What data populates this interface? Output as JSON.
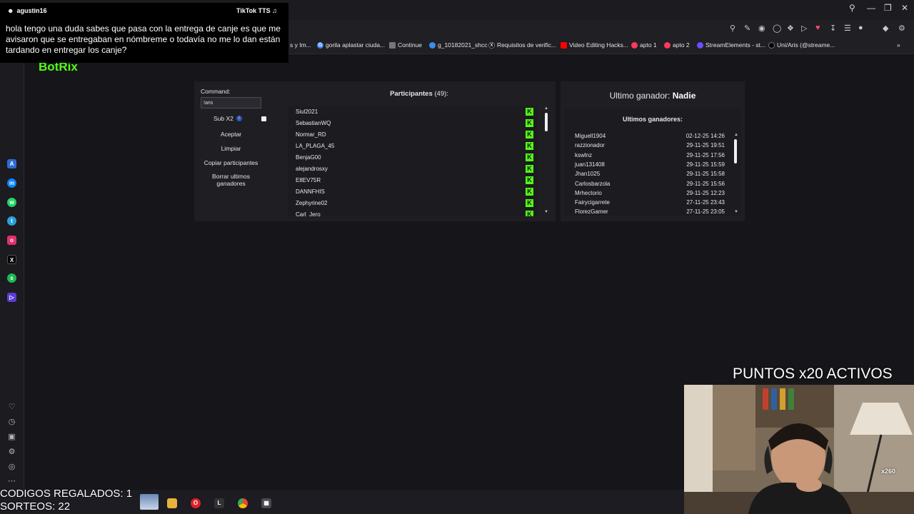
{
  "tts": {
    "user": "agustin16",
    "brand": "TikTok TTS",
    "message": "hola tengo una duda sabes que pasa con la entrega de canje es que me avisaron que se entregaban en nómbreme o todavía no me lo dan están tardando en entregar los canje?"
  },
  "bookmarks": [
    {
      "label": "s y Im..."
    },
    {
      "label": "gorila aplastar ciuda..."
    },
    {
      "label": "Continue"
    },
    {
      "label": "g_10182021_shcc"
    },
    {
      "label": "Requisitos de verific..."
    },
    {
      "label": "Video Editing Hacks..."
    },
    {
      "label": "apto 1"
    },
    {
      "label": "apto 2"
    },
    {
      "label": "StreamElements - st..."
    },
    {
      "label": "Uni/Aris (@streame..."
    }
  ],
  "brand": "BotRix",
  "giveaway": {
    "command_label": "Command:",
    "command_value": "!aris",
    "sub_label": "Sub X2",
    "buttons": {
      "accept": "Aceptar",
      "clear": "Limpiar",
      "copy": "Copiar participantes",
      "delete_winners": "Borrar ultimos ganadores"
    },
    "participants_label": "Participantes",
    "participants_count": "(49):",
    "participants": [
      "Siul2021",
      "SebastianWQ",
      "Normar_RD",
      "LA_PLAGA_45",
      "BenjaG00",
      "alejandrosxy",
      "E8EV75R",
      "DANNFHIS",
      "Zephyrine02",
      "Carl_Jero"
    ],
    "kick_badge": "K",
    "last_winner_label": "Ultimo ganador:",
    "last_winner_value": "Nadie",
    "winners_title": "Ultimos ganadores:",
    "winners": [
      {
        "name": "Miguell1904",
        "date": "02-12-25 14:26"
      },
      {
        "name": "razzionador",
        "date": "29-11-25 19:51"
      },
      {
        "name": "kswlnz",
        "date": "29-11-25 17:56"
      },
      {
        "name": "juan131408",
        "date": "29-11-25 15:59"
      },
      {
        "name": "Jhan1025",
        "date": "29-11-25 15:58"
      },
      {
        "name": "Carlosbarzola",
        "date": "29-11-25 15:56"
      },
      {
        "name": "Mrhectorio",
        "date": "29-11-25 12:23"
      },
      {
        "name": "Fairycigarrete",
        "date": "27-11-25 23:43"
      },
      {
        "name": "FlorezGamer",
        "date": "27-11-25 23:05"
      }
    ]
  },
  "overlay": {
    "codes": "CODIGOS REGALADOS: 1",
    "raffles": "SORTEOS: 22",
    "points": "PUNTOS x20 ACTIVOS",
    "cam_badge": "x260"
  },
  "colors": {
    "kick_green": "#53fc18",
    "background": "#16161a",
    "panel": "#1e1e23"
  }
}
